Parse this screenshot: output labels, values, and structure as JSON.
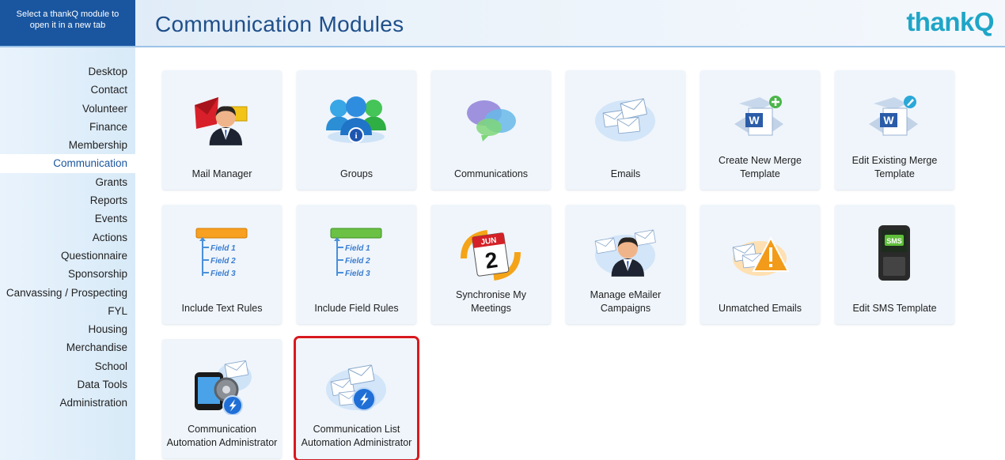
{
  "header": {
    "hint_line1": "Select a thankQ module to",
    "hint_line2": "open it in a new tab",
    "title": "Communication Modules",
    "logo_text": "thank",
    "logo_q": "Q"
  },
  "sidebar": {
    "items": [
      {
        "label": "Desktop"
      },
      {
        "label": "Contact"
      },
      {
        "label": "Volunteer"
      },
      {
        "label": "Finance"
      },
      {
        "label": "Membership"
      },
      {
        "label": "Communication"
      },
      {
        "label": "Grants"
      },
      {
        "label": "Reports"
      },
      {
        "label": "Events"
      },
      {
        "label": "Actions"
      },
      {
        "label": "Questionnaire"
      },
      {
        "label": "Sponsorship"
      },
      {
        "label": "Canvassing / Prospecting"
      },
      {
        "label": "FYL"
      },
      {
        "label": "Housing"
      },
      {
        "label": "Merchandise"
      },
      {
        "label": "School"
      },
      {
        "label": "Data Tools"
      },
      {
        "label": "Administration"
      }
    ],
    "active": "Communication"
  },
  "tiles": [
    {
      "label": "Mail Manager",
      "icon": "mail-manager-icon"
    },
    {
      "label": "Groups",
      "icon": "groups-icon"
    },
    {
      "label": "Communications",
      "icon": "communications-icon"
    },
    {
      "label": "Emails",
      "icon": "emails-icon"
    },
    {
      "label": "Create New Merge Template",
      "icon": "create-merge-template-icon"
    },
    {
      "label": "Edit Existing Merge Template",
      "icon": "edit-merge-template-icon"
    },
    {
      "label": "Include Text Rules",
      "icon": "include-text-rules-icon"
    },
    {
      "label": "Include Field Rules",
      "icon": "include-field-rules-icon"
    },
    {
      "label": "Synchronise My Meetings",
      "icon": "synchronise-meetings-icon"
    },
    {
      "label": "Manage eMailer Campaigns",
      "icon": "emailer-campaigns-icon"
    },
    {
      "label": "Unmatched Emails",
      "icon": "unmatched-emails-icon"
    },
    {
      "label": "Edit SMS Template",
      "icon": "sms-template-icon"
    },
    {
      "label": "Communication Automation Administrator",
      "icon": "communication-automation-icon"
    },
    {
      "label": "Communication List Automation Administrator",
      "icon": "communication-list-automation-icon"
    }
  ],
  "rule_fields": [
    "Field 1",
    "Field 2",
    "Field 3"
  ],
  "calendar": {
    "month": "JUN",
    "day": "2"
  },
  "sms_text": "SMS",
  "merge_letter": "W",
  "colors": {
    "hint_bg": "#1a56a0",
    "title": "#1f4f8a",
    "logo": "#1fa5c7",
    "active_item": "#1a56a0",
    "tile_bg": "#eff5fb",
    "highlight": "#d7191f"
  }
}
